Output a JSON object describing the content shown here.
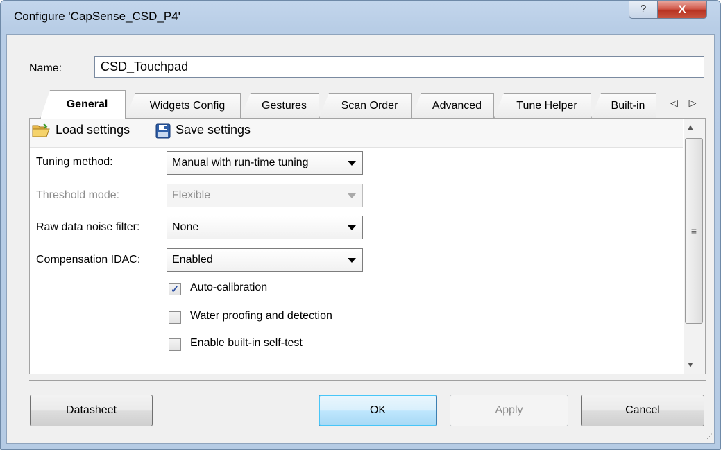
{
  "window": {
    "title": "Configure 'CapSense_CSD_P4'",
    "help_glyph": "?",
    "close_glyph": "X"
  },
  "name_field": {
    "label": "Name:",
    "value": "CSD_Touchpad"
  },
  "tabs": [
    {
      "label": "General",
      "active": true
    },
    {
      "label": "Widgets Config"
    },
    {
      "label": "Gestures"
    },
    {
      "label": "Scan Order"
    },
    {
      "label": "Advanced"
    },
    {
      "label": "Tune Helper"
    },
    {
      "label": "Built-in"
    }
  ],
  "tab_scroll_arrows": "◁ ▷",
  "toolbar": {
    "load_label": "Load settings",
    "save_label": "Save settings",
    "load_icon": "folder-open-icon",
    "save_icon": "floppy-disk-icon"
  },
  "form": {
    "tuning_method": {
      "label": "Tuning method:",
      "value": "Manual with run-time tuning"
    },
    "threshold_mode": {
      "label": "Threshold mode:",
      "value": "Flexible",
      "disabled": true
    },
    "raw_filter": {
      "label": "Raw data noise filter:",
      "value": "None"
    },
    "comp_idac": {
      "label": "Compensation IDAC:",
      "value": "Enabled"
    },
    "checkboxes": [
      {
        "label": "Auto-calibration",
        "checked": true
      },
      {
        "label": "Water proofing and detection",
        "checked": false
      },
      {
        "label": "Enable built-in self-test",
        "checked": false
      }
    ]
  },
  "scrollbar": {
    "thumb_grip": "≡",
    "up": "▲",
    "down": "▼"
  },
  "buttons": {
    "datasheet": "Datasheet",
    "ok": "OK",
    "apply": "Apply",
    "cancel": "Cancel"
  },
  "colors": {
    "title_bar": "#b8cde6",
    "close_button": "#c8493a",
    "default_button_border": "#3c7fb1"
  }
}
